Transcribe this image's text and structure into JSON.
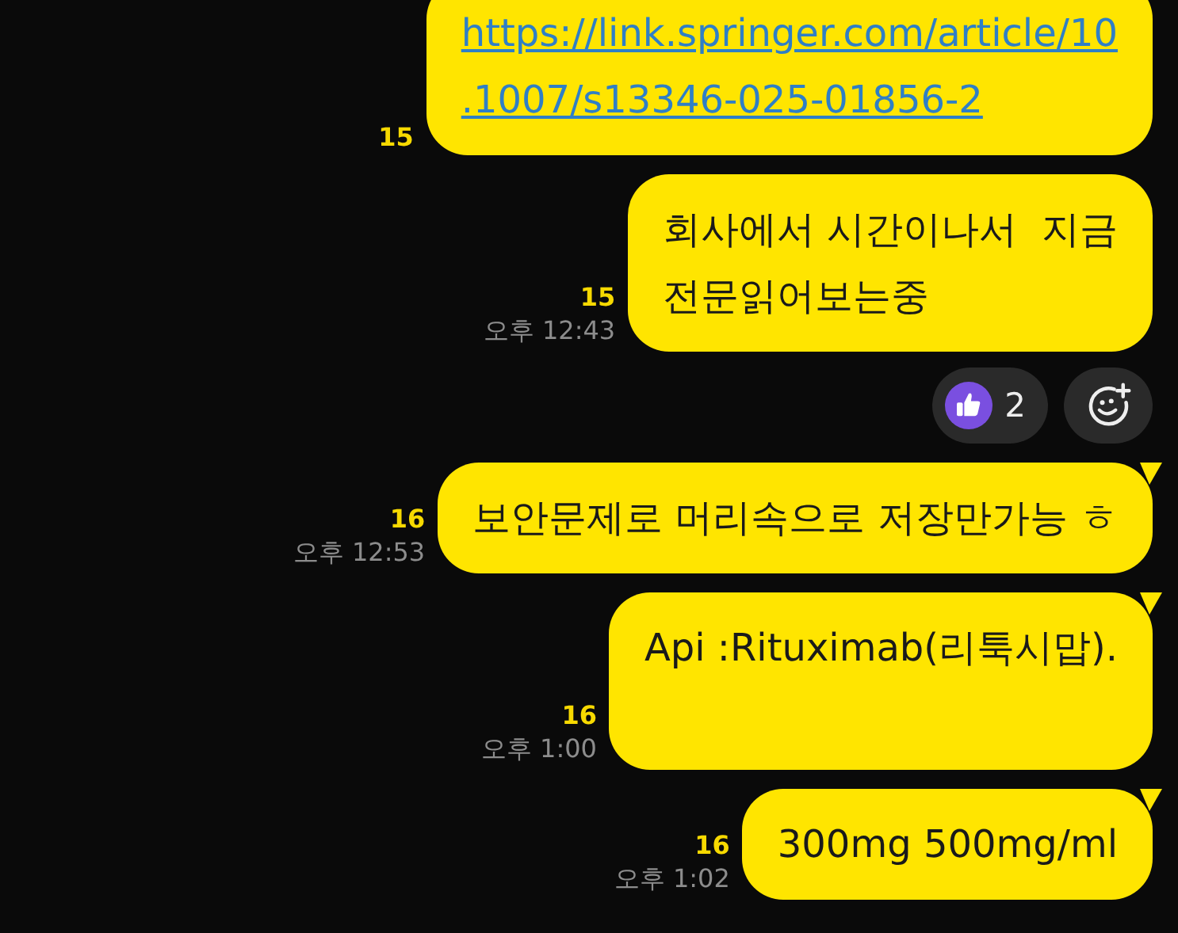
{
  "messages": [
    {
      "kind": "link",
      "text": "https://link.springer.com/article/10\n.1007/s13346-025-01856-2",
      "unread": "15",
      "cut_top": true,
      "tail": false
    },
    {
      "kind": "text",
      "text": "회사에서 시간이나서  지금\n전문읽어보는중",
      "unread": "15",
      "time": "오후 12:43",
      "tail": false
    },
    {
      "kind": "reactions",
      "reactions": [
        {
          "count": "2"
        }
      ]
    },
    {
      "kind": "text",
      "text": "보안문제로 머리속으로 저장만가능 ㅎ",
      "unread": "16",
      "time": "오후 12:53",
      "tail": true
    },
    {
      "kind": "text",
      "text": "Api :Rituximab(리툭시맙).",
      "unread": "16",
      "time": "오후 1:00",
      "tail": true,
      "trailing_blank": true
    },
    {
      "kind": "text",
      "text": "300mg 500mg/ml",
      "unread": "16",
      "time": "오후 1:02",
      "tail": true
    }
  ]
}
